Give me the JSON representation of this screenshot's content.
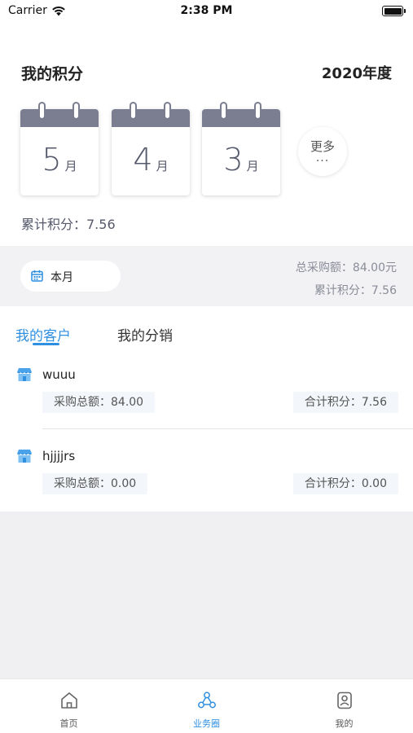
{
  "status_bar": {
    "carrier": "Carrier",
    "time": "2:38 PM"
  },
  "header": {
    "title": "我的积分",
    "year": "2020年度"
  },
  "months": [
    {
      "num": "5",
      "unit": "月"
    },
    {
      "num": "4",
      "unit": "月"
    },
    {
      "num": "3",
      "unit": "月"
    }
  ],
  "more": {
    "label": "更多",
    "dots": "..."
  },
  "accumulated": "累计积分：7.56",
  "filter": {
    "month_label": "本月",
    "total_purchase": "总采购额：84.00元",
    "total_points": "累计积分：7.56"
  },
  "tabs": [
    {
      "label": "我的客户"
    },
    {
      "label": "我的分销"
    }
  ],
  "customers": [
    {
      "name": "wuuu",
      "purchase": "采购总额：84.00",
      "points": "合计积分：7.56"
    },
    {
      "name": "hjjjjrs",
      "purchase": "采购总额：0.00",
      "points": "合计积分：0.00"
    }
  ],
  "tab_bar": [
    {
      "label": "首页",
      "icon": "home-icon"
    },
    {
      "label": "业务圈",
      "icon": "business-circle-icon"
    },
    {
      "label": "我的",
      "icon": "profile-icon"
    }
  ],
  "colors": {
    "accent": "#2f8fe0",
    "calendar_header": "#7a7e90"
  }
}
